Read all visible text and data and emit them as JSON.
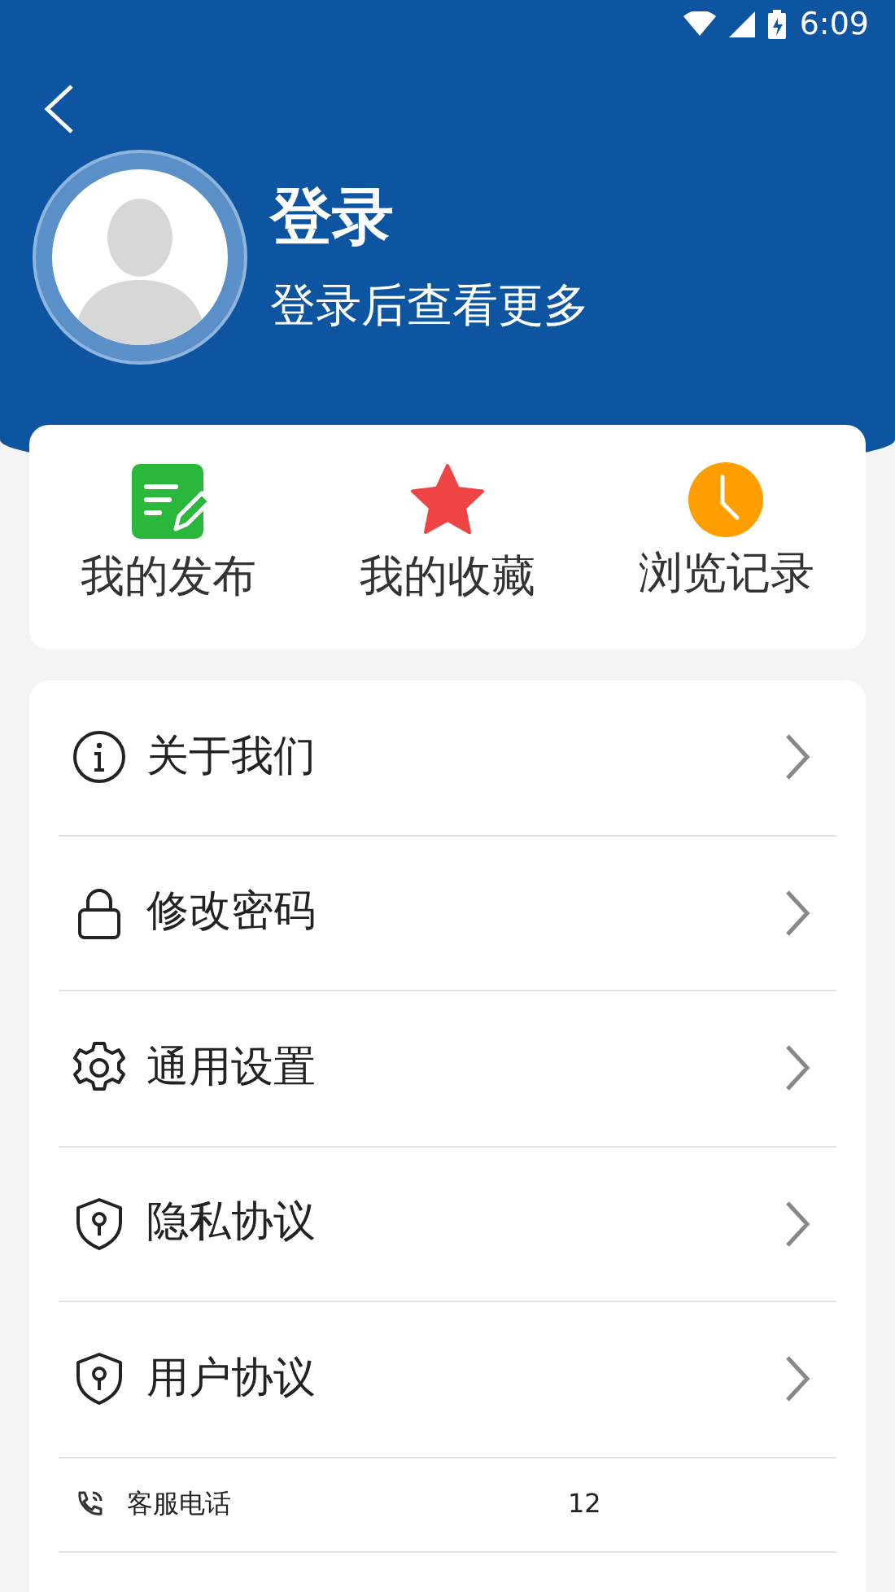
{
  "status_bar": {
    "time": "6:09"
  },
  "profile": {
    "title": "登录",
    "subtitle": "登录后查看更多"
  },
  "shortcuts": [
    {
      "label": "我的发布",
      "kind": "publish"
    },
    {
      "label": "我的收藏",
      "kind": "favorite"
    },
    {
      "label": "浏览记录",
      "kind": "history"
    }
  ],
  "menu": [
    {
      "label": "关于我们",
      "kind": "info"
    },
    {
      "label": "修改密码",
      "kind": "lock"
    },
    {
      "label": "通用设置",
      "kind": "settings"
    },
    {
      "label": "隐私协议",
      "kind": "shield"
    },
    {
      "label": "用户协议",
      "kind": "shield"
    }
  ],
  "contacts": [
    {
      "label": "客服电话",
      "value": "12",
      "kind": "phone"
    }
  ]
}
